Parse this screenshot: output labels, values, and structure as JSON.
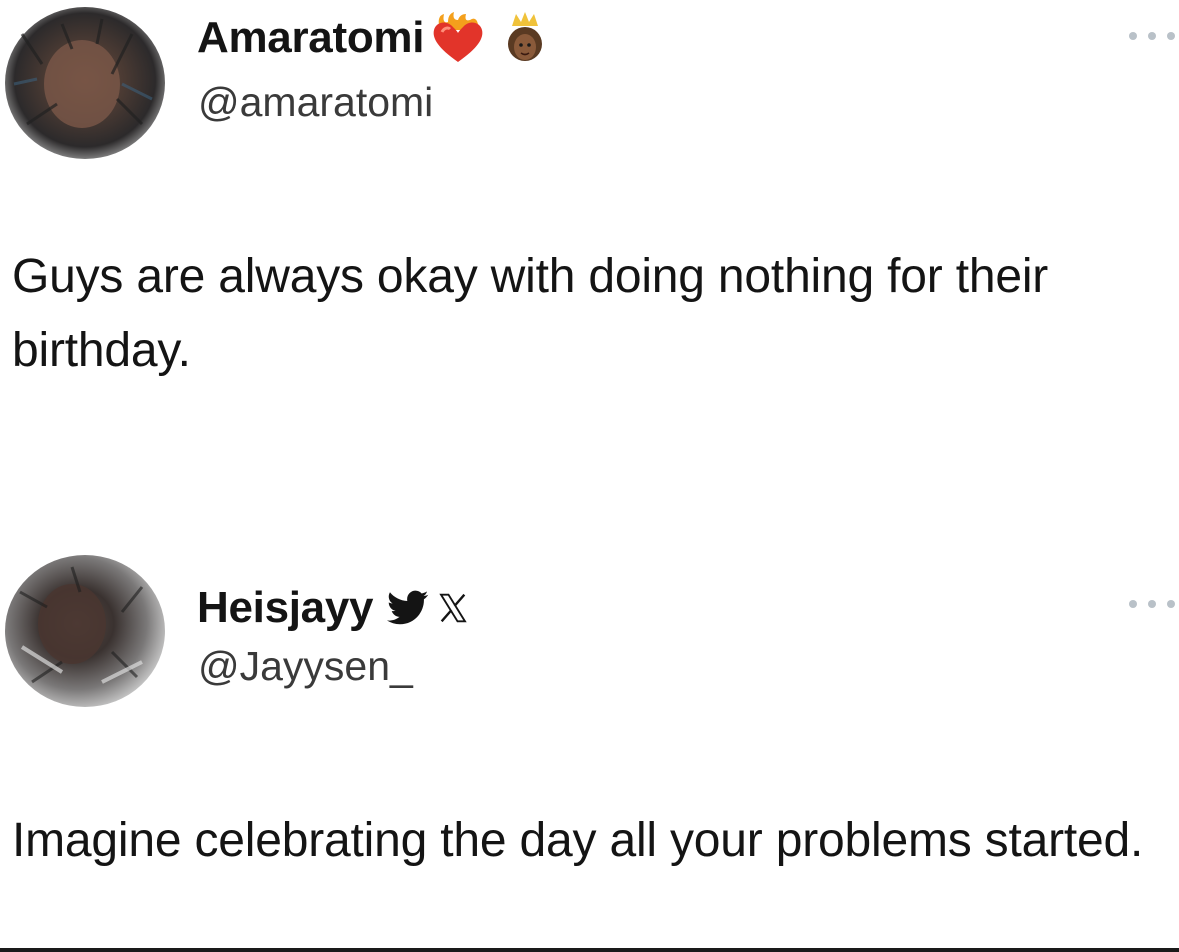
{
  "tweets": [
    {
      "display_name": "Amaratomi",
      "handle": "@amaratomi",
      "badges": [
        "heart-on-fire-icon",
        "princess-emoji-icon"
      ],
      "text": "Guys are always okay with doing nothing for their birthday."
    },
    {
      "display_name": "Heisjayy",
      "handle": "@Jayysen_",
      "badges": [
        "twitter-bird-icon",
        "x-logo-icon"
      ],
      "text": "Imagine celebrating the day all your problems started."
    }
  ],
  "colors": {
    "text": "#141414",
    "handle": "#3a3a3a",
    "more_dots": "#b9c1c8",
    "background": "#ffffff"
  }
}
